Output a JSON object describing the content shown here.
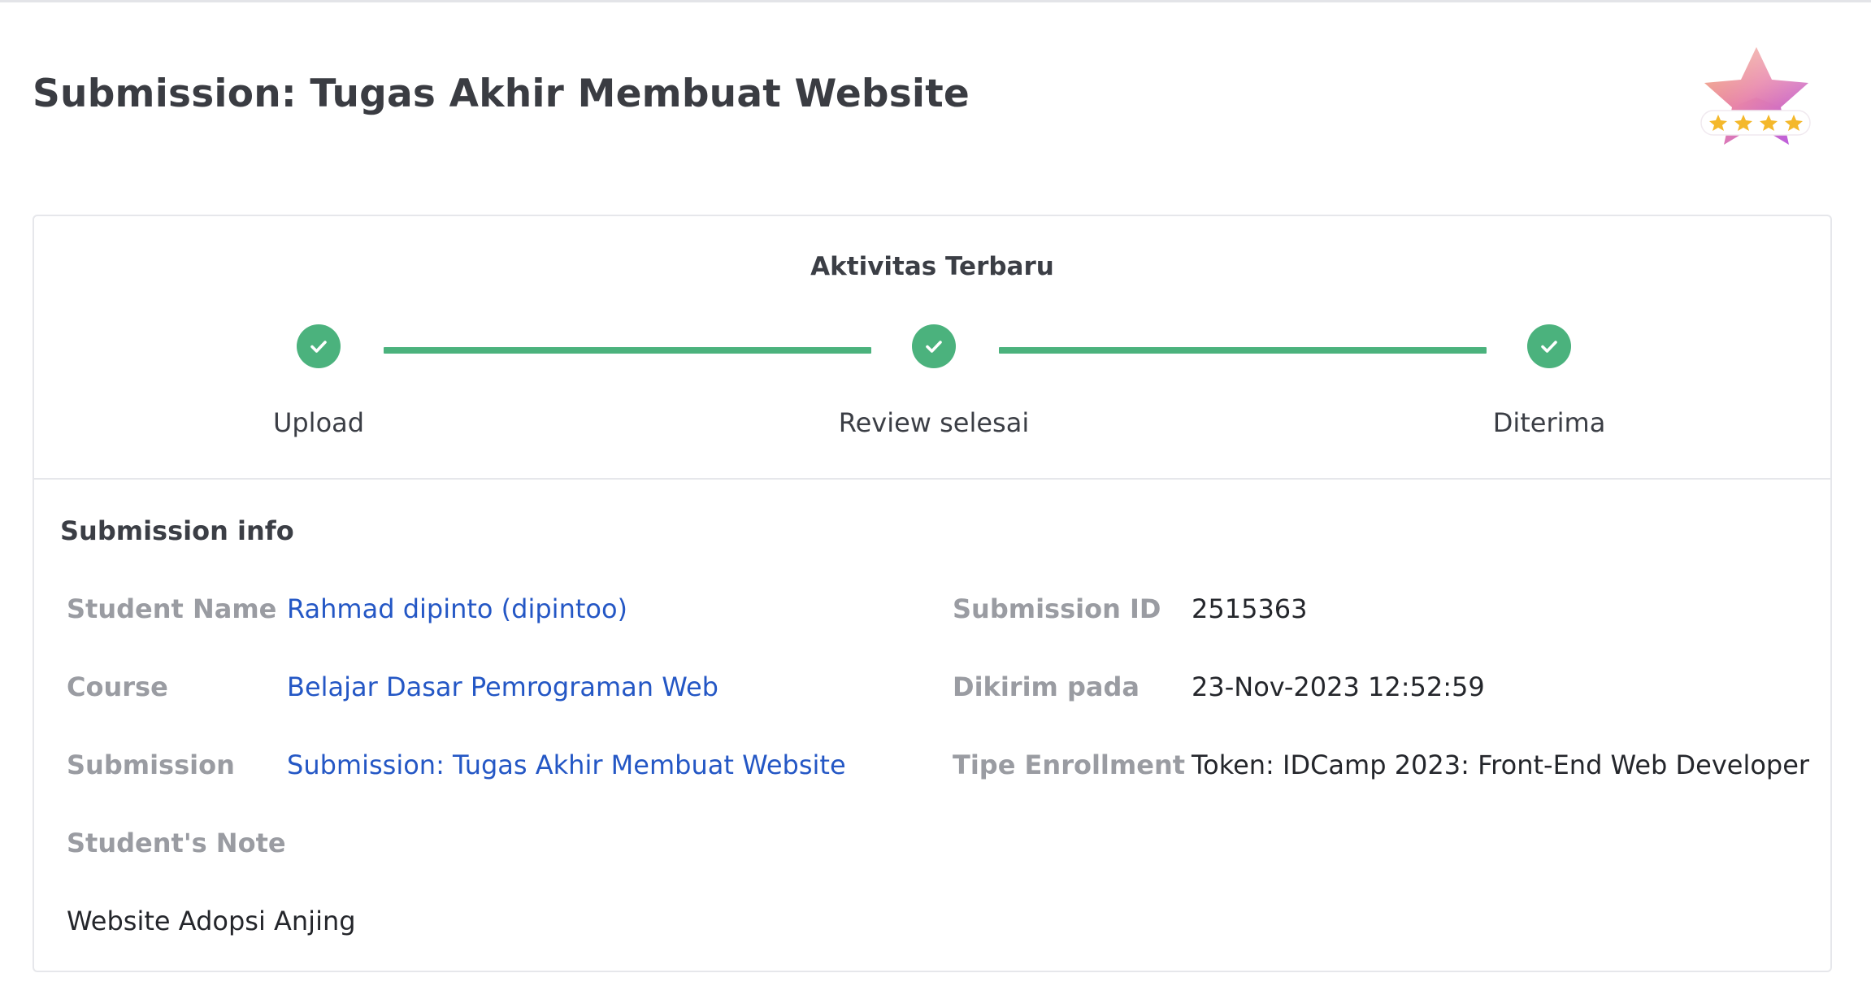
{
  "page": {
    "title": "Submission: Tugas Akhir Membuat Website",
    "badge_icon": "star-rating-badge-icon"
  },
  "activity": {
    "title": "Aktivitas Terbaru",
    "steps": [
      {
        "label": "Upload",
        "status": "done",
        "icon": "check-icon"
      },
      {
        "label": "Review selesai",
        "status": "done",
        "icon": "check-icon"
      },
      {
        "label": "Diterima",
        "status": "done",
        "icon": "check-icon"
      }
    ]
  },
  "info": {
    "title": "Submission info",
    "student_name": {
      "label": "Student Name",
      "value": "Rahmad dipinto (dipintoo)"
    },
    "course": {
      "label": "Course",
      "value": "Belajar Dasar Pemrograman Web"
    },
    "submission": {
      "label": "Submission",
      "value": "Submission: Tugas Akhir Membuat Website"
    },
    "submission_id": {
      "label": "Submission ID",
      "value": "2515363"
    },
    "sent_at": {
      "label": "Dikirim pada",
      "value": "23-Nov-2023 12:52:59"
    },
    "enrollment_type": {
      "label": "Tipe Enrollment",
      "value": "Token: IDCamp 2023: Front-End Web Developer"
    },
    "note": {
      "label": "Student's Note",
      "value": "Website Adopsi Anjing"
    }
  },
  "colors": {
    "accent_green": "#4bb27d",
    "link_blue": "#2457c5",
    "label_gray": "#9a9ca2",
    "border": "#e6e7eb"
  }
}
